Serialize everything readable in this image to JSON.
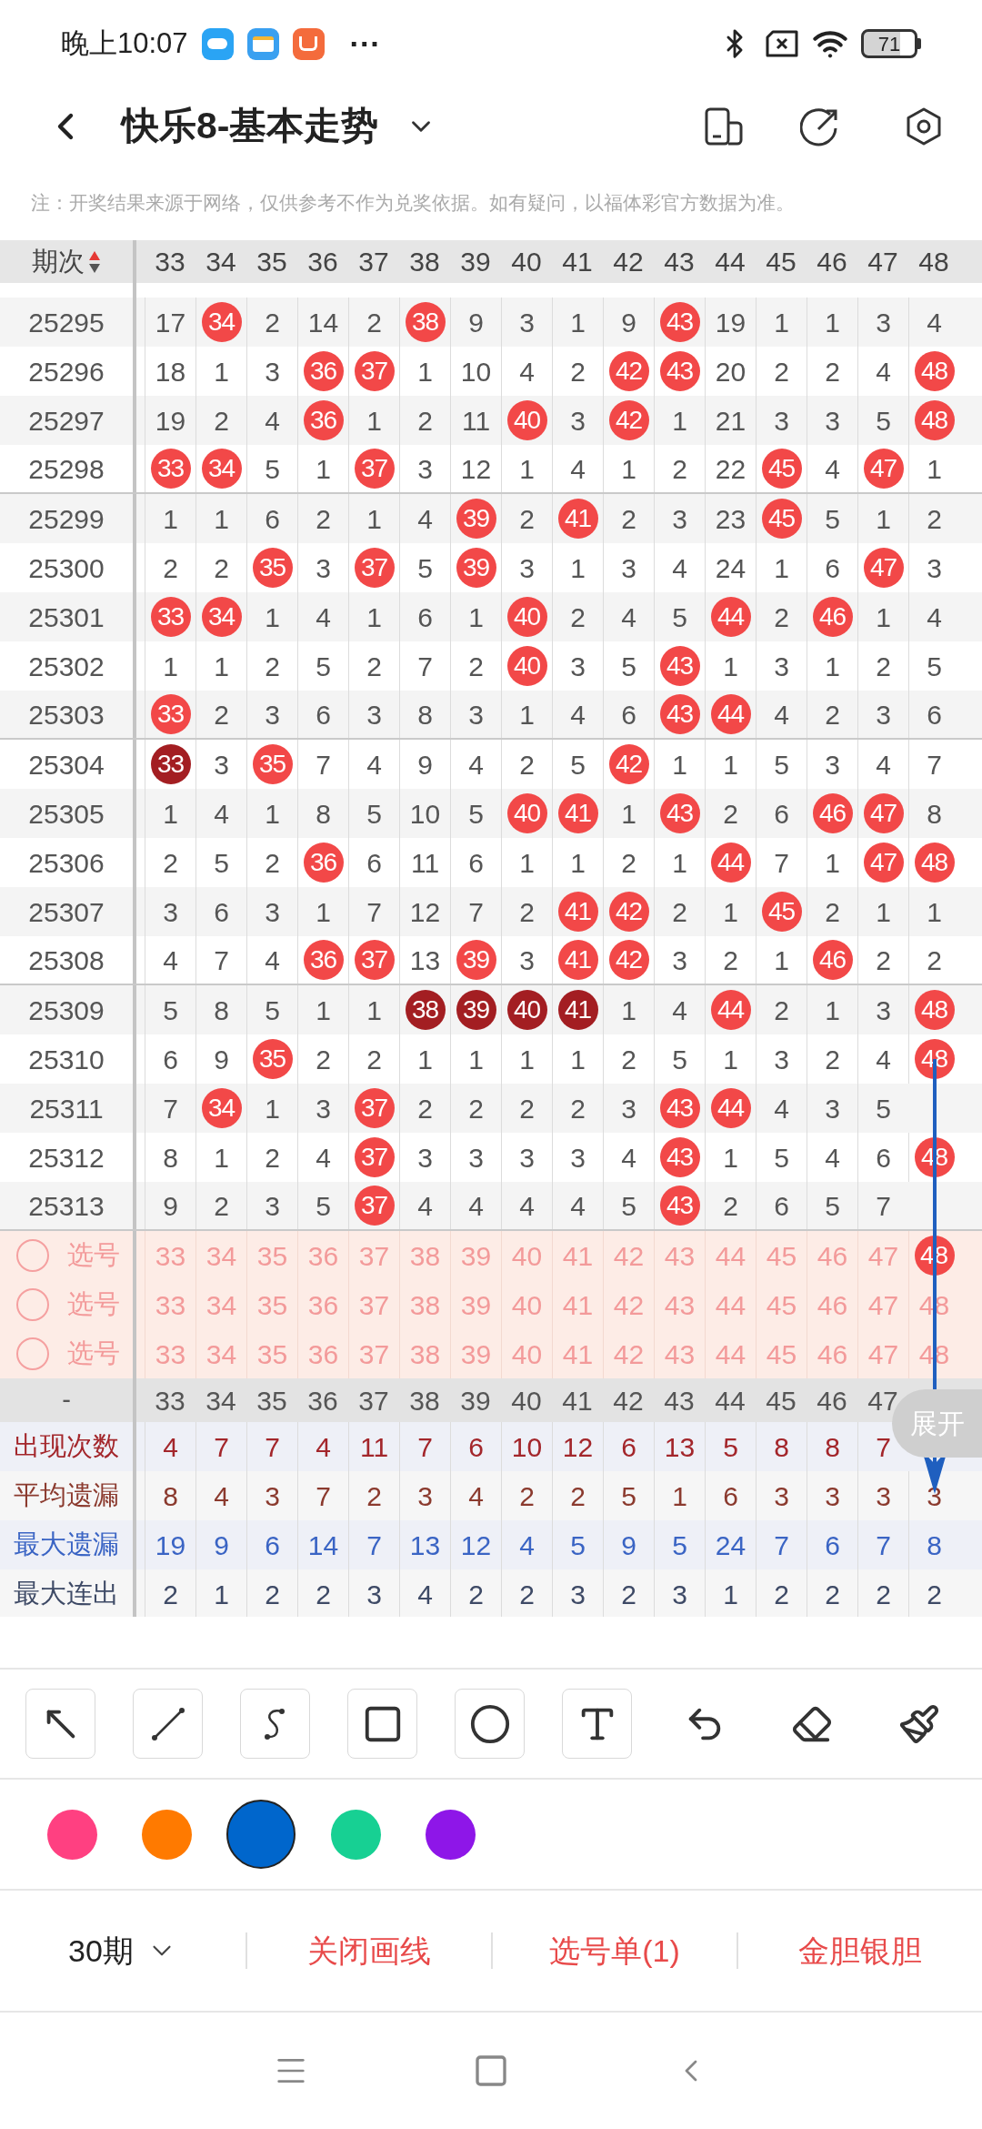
{
  "status_bar": {
    "time": "晚上10:07",
    "more": "···",
    "battery": "71"
  },
  "header": {
    "title": "快乐8-基本走势"
  },
  "notice": "注：开奖结果来源于网络，仅供参考不作为兑奖依据。如有疑问，以福体彩官方数据为准。",
  "table": {
    "period_header": "期次",
    "columns": [
      "33",
      "34",
      "35",
      "36",
      "37",
      "38",
      "39",
      "40",
      "41",
      "42",
      "43",
      "44",
      "45",
      "46",
      "47",
      "48"
    ],
    "rows": [
      {
        "period": "25295",
        "cells": [
          {
            "v": "17",
            "kind": "miss"
          },
          {
            "v": "34",
            "kind": "hit"
          },
          {
            "v": "2",
            "kind": "miss"
          },
          {
            "v": "14",
            "kind": "miss"
          },
          {
            "v": "2",
            "kind": "miss"
          },
          {
            "v": "38",
            "kind": "hit"
          },
          {
            "v": "9",
            "kind": "miss"
          },
          {
            "v": "3",
            "kind": "miss"
          },
          {
            "v": "1",
            "kind": "miss"
          },
          {
            "v": "9",
            "kind": "miss"
          },
          {
            "v": "43",
            "kind": "hit"
          },
          {
            "v": "19",
            "kind": "miss"
          },
          {
            "v": "1",
            "kind": "miss"
          },
          {
            "v": "1",
            "kind": "miss"
          },
          {
            "v": "3",
            "kind": "miss"
          },
          {
            "v": "4",
            "kind": "miss"
          }
        ]
      },
      {
        "period": "25296",
        "cells": [
          {
            "v": "18",
            "kind": "miss"
          },
          {
            "v": "1",
            "kind": "miss"
          },
          {
            "v": "3",
            "kind": "miss"
          },
          {
            "v": "36",
            "kind": "hit"
          },
          {
            "v": "37",
            "kind": "hit"
          },
          {
            "v": "1",
            "kind": "miss"
          },
          {
            "v": "10",
            "kind": "miss"
          },
          {
            "v": "4",
            "kind": "miss"
          },
          {
            "v": "2",
            "kind": "miss"
          },
          {
            "v": "42",
            "kind": "hit"
          },
          {
            "v": "43",
            "kind": "hit"
          },
          {
            "v": "20",
            "kind": "miss"
          },
          {
            "v": "2",
            "kind": "miss"
          },
          {
            "v": "2",
            "kind": "miss"
          },
          {
            "v": "4",
            "kind": "miss"
          },
          {
            "v": "48",
            "kind": "hit"
          }
        ]
      },
      {
        "period": "25297",
        "cells": [
          {
            "v": "19",
            "kind": "miss"
          },
          {
            "v": "2",
            "kind": "miss"
          },
          {
            "v": "4",
            "kind": "miss"
          },
          {
            "v": "36",
            "kind": "hit"
          },
          {
            "v": "1",
            "kind": "miss"
          },
          {
            "v": "2",
            "kind": "miss"
          },
          {
            "v": "11",
            "kind": "miss"
          },
          {
            "v": "40",
            "kind": "hit"
          },
          {
            "v": "3",
            "kind": "miss"
          },
          {
            "v": "42",
            "kind": "hit"
          },
          {
            "v": "1",
            "kind": "miss"
          },
          {
            "v": "21",
            "kind": "miss"
          },
          {
            "v": "3",
            "kind": "miss"
          },
          {
            "v": "3",
            "kind": "miss"
          },
          {
            "v": "5",
            "kind": "miss"
          },
          {
            "v": "48",
            "kind": "hit"
          }
        ]
      },
      {
        "period": "25298",
        "cells": [
          {
            "v": "33",
            "kind": "hit"
          },
          {
            "v": "34",
            "kind": "hit"
          },
          {
            "v": "5",
            "kind": "miss"
          },
          {
            "v": "1",
            "kind": "miss"
          },
          {
            "v": "37",
            "kind": "hit"
          },
          {
            "v": "3",
            "kind": "miss"
          },
          {
            "v": "12",
            "kind": "miss"
          },
          {
            "v": "1",
            "kind": "miss"
          },
          {
            "v": "4",
            "kind": "miss"
          },
          {
            "v": "1",
            "kind": "miss"
          },
          {
            "v": "2",
            "kind": "miss"
          },
          {
            "v": "22",
            "kind": "miss"
          },
          {
            "v": "45",
            "kind": "hit"
          },
          {
            "v": "4",
            "kind": "miss"
          },
          {
            "v": "47",
            "kind": "hit"
          },
          {
            "v": "1",
            "kind": "miss"
          }
        ]
      },
      {
        "period": "25299",
        "cells": [
          {
            "v": "1",
            "kind": "miss"
          },
          {
            "v": "1",
            "kind": "miss"
          },
          {
            "v": "6",
            "kind": "miss"
          },
          {
            "v": "2",
            "kind": "miss"
          },
          {
            "v": "1",
            "kind": "miss"
          },
          {
            "v": "4",
            "kind": "miss"
          },
          {
            "v": "39",
            "kind": "hit"
          },
          {
            "v": "2",
            "kind": "miss"
          },
          {
            "v": "41",
            "kind": "hit"
          },
          {
            "v": "2",
            "kind": "miss"
          },
          {
            "v": "3",
            "kind": "miss"
          },
          {
            "v": "23",
            "kind": "miss"
          },
          {
            "v": "45",
            "kind": "hit"
          },
          {
            "v": "5",
            "kind": "miss"
          },
          {
            "v": "1",
            "kind": "miss"
          },
          {
            "v": "2",
            "kind": "miss"
          }
        ]
      },
      {
        "period": "25300",
        "cells": [
          {
            "v": "2",
            "kind": "miss"
          },
          {
            "v": "2",
            "kind": "miss"
          },
          {
            "v": "35",
            "kind": "hit"
          },
          {
            "v": "3",
            "kind": "miss"
          },
          {
            "v": "37",
            "kind": "hit"
          },
          {
            "v": "5",
            "kind": "miss"
          },
          {
            "v": "39",
            "kind": "hit"
          },
          {
            "v": "3",
            "kind": "miss"
          },
          {
            "v": "1",
            "kind": "miss"
          },
          {
            "v": "3",
            "kind": "miss"
          },
          {
            "v": "4",
            "kind": "miss"
          },
          {
            "v": "24",
            "kind": "miss"
          },
          {
            "v": "1",
            "kind": "miss"
          },
          {
            "v": "6",
            "kind": "miss"
          },
          {
            "v": "47",
            "kind": "hit"
          },
          {
            "v": "3",
            "kind": "miss"
          }
        ]
      },
      {
        "period": "25301",
        "cells": [
          {
            "v": "33",
            "kind": "hit"
          },
          {
            "v": "34",
            "kind": "hit"
          },
          {
            "v": "1",
            "kind": "miss"
          },
          {
            "v": "4",
            "kind": "miss"
          },
          {
            "v": "1",
            "kind": "miss"
          },
          {
            "v": "6",
            "kind": "miss"
          },
          {
            "v": "1",
            "kind": "miss"
          },
          {
            "v": "40",
            "kind": "hit"
          },
          {
            "v": "2",
            "kind": "miss"
          },
          {
            "v": "4",
            "kind": "miss"
          },
          {
            "v": "5",
            "kind": "miss"
          },
          {
            "v": "44",
            "kind": "hit"
          },
          {
            "v": "2",
            "kind": "miss"
          },
          {
            "v": "46",
            "kind": "hit"
          },
          {
            "v": "1",
            "kind": "miss"
          },
          {
            "v": "4",
            "kind": "miss"
          }
        ]
      },
      {
        "period": "25302",
        "cells": [
          {
            "v": "1",
            "kind": "miss"
          },
          {
            "v": "1",
            "kind": "miss"
          },
          {
            "v": "2",
            "kind": "miss"
          },
          {
            "v": "5",
            "kind": "miss"
          },
          {
            "v": "2",
            "kind": "miss"
          },
          {
            "v": "7",
            "kind": "miss"
          },
          {
            "v": "2",
            "kind": "miss"
          },
          {
            "v": "40",
            "kind": "hit"
          },
          {
            "v": "3",
            "kind": "miss"
          },
          {
            "v": "5",
            "kind": "miss"
          },
          {
            "v": "43",
            "kind": "hit"
          },
          {
            "v": "1",
            "kind": "miss"
          },
          {
            "v": "3",
            "kind": "miss"
          },
          {
            "v": "1",
            "kind": "miss"
          },
          {
            "v": "2",
            "kind": "miss"
          },
          {
            "v": "5",
            "kind": "miss"
          }
        ]
      },
      {
        "period": "25303",
        "cells": [
          {
            "v": "33",
            "kind": "hit"
          },
          {
            "v": "2",
            "kind": "miss"
          },
          {
            "v": "3",
            "kind": "miss"
          },
          {
            "v": "6",
            "kind": "miss"
          },
          {
            "v": "3",
            "kind": "miss"
          },
          {
            "v": "8",
            "kind": "miss"
          },
          {
            "v": "3",
            "kind": "miss"
          },
          {
            "v": "1",
            "kind": "miss"
          },
          {
            "v": "4",
            "kind": "miss"
          },
          {
            "v": "6",
            "kind": "miss"
          },
          {
            "v": "43",
            "kind": "hit"
          },
          {
            "v": "44",
            "kind": "hit"
          },
          {
            "v": "4",
            "kind": "miss"
          },
          {
            "v": "2",
            "kind": "miss"
          },
          {
            "v": "3",
            "kind": "miss"
          },
          {
            "v": "6",
            "kind": "miss"
          }
        ]
      },
      {
        "period": "25304",
        "cells": [
          {
            "v": "33",
            "kind": "repeat"
          },
          {
            "v": "3",
            "kind": "miss"
          },
          {
            "v": "35",
            "kind": "hit"
          },
          {
            "v": "7",
            "kind": "miss"
          },
          {
            "v": "4",
            "kind": "miss"
          },
          {
            "v": "9",
            "kind": "miss"
          },
          {
            "v": "4",
            "kind": "miss"
          },
          {
            "v": "2",
            "kind": "miss"
          },
          {
            "v": "5",
            "kind": "miss"
          },
          {
            "v": "42",
            "kind": "hit"
          },
          {
            "v": "1",
            "kind": "miss"
          },
          {
            "v": "1",
            "kind": "miss"
          },
          {
            "v": "5",
            "kind": "miss"
          },
          {
            "v": "3",
            "kind": "miss"
          },
          {
            "v": "4",
            "kind": "miss"
          },
          {
            "v": "7",
            "kind": "miss"
          }
        ]
      },
      {
        "period": "25305",
        "cells": [
          {
            "v": "1",
            "kind": "miss"
          },
          {
            "v": "4",
            "kind": "miss"
          },
          {
            "v": "1",
            "kind": "miss"
          },
          {
            "v": "8",
            "kind": "miss"
          },
          {
            "v": "5",
            "kind": "miss"
          },
          {
            "v": "10",
            "kind": "miss"
          },
          {
            "v": "5",
            "kind": "miss"
          },
          {
            "v": "40",
            "kind": "hit"
          },
          {
            "v": "41",
            "kind": "hit"
          },
          {
            "v": "1",
            "kind": "miss"
          },
          {
            "v": "43",
            "kind": "hit"
          },
          {
            "v": "2",
            "kind": "miss"
          },
          {
            "v": "6",
            "kind": "miss"
          },
          {
            "v": "46",
            "kind": "hit"
          },
          {
            "v": "47",
            "kind": "hit"
          },
          {
            "v": "8",
            "kind": "miss"
          }
        ]
      },
      {
        "period": "25306",
        "cells": [
          {
            "v": "2",
            "kind": "miss"
          },
          {
            "v": "5",
            "kind": "miss"
          },
          {
            "v": "2",
            "kind": "miss"
          },
          {
            "v": "36",
            "kind": "hit"
          },
          {
            "v": "6",
            "kind": "miss"
          },
          {
            "v": "11",
            "kind": "miss"
          },
          {
            "v": "6",
            "kind": "miss"
          },
          {
            "v": "1",
            "kind": "miss"
          },
          {
            "v": "1",
            "kind": "miss"
          },
          {
            "v": "2",
            "kind": "miss"
          },
          {
            "v": "1",
            "kind": "miss"
          },
          {
            "v": "44",
            "kind": "hit"
          },
          {
            "v": "7",
            "kind": "miss"
          },
          {
            "v": "1",
            "kind": "miss"
          },
          {
            "v": "47",
            "kind": "hit"
          },
          {
            "v": "48",
            "kind": "hit"
          }
        ]
      },
      {
        "period": "25307",
        "cells": [
          {
            "v": "3",
            "kind": "miss"
          },
          {
            "v": "6",
            "kind": "miss"
          },
          {
            "v": "3",
            "kind": "miss"
          },
          {
            "v": "1",
            "kind": "miss"
          },
          {
            "v": "7",
            "kind": "miss"
          },
          {
            "v": "12",
            "kind": "miss"
          },
          {
            "v": "7",
            "kind": "miss"
          },
          {
            "v": "2",
            "kind": "miss"
          },
          {
            "v": "41",
            "kind": "hit"
          },
          {
            "v": "42",
            "kind": "hit"
          },
          {
            "v": "2",
            "kind": "miss"
          },
          {
            "v": "1",
            "kind": "miss"
          },
          {
            "v": "45",
            "kind": "hit"
          },
          {
            "v": "2",
            "kind": "miss"
          },
          {
            "v": "1",
            "kind": "miss"
          },
          {
            "v": "1",
            "kind": "miss"
          }
        ]
      },
      {
        "period": "25308",
        "cells": [
          {
            "v": "4",
            "kind": "miss"
          },
          {
            "v": "7",
            "kind": "miss"
          },
          {
            "v": "4",
            "kind": "miss"
          },
          {
            "v": "36",
            "kind": "hit"
          },
          {
            "v": "37",
            "kind": "hit"
          },
          {
            "v": "13",
            "kind": "miss"
          },
          {
            "v": "39",
            "kind": "hit"
          },
          {
            "v": "3",
            "kind": "miss"
          },
          {
            "v": "41",
            "kind": "hit"
          },
          {
            "v": "42",
            "kind": "hit"
          },
          {
            "v": "3",
            "kind": "miss"
          },
          {
            "v": "2",
            "kind": "miss"
          },
          {
            "v": "1",
            "kind": "miss"
          },
          {
            "v": "46",
            "kind": "hit"
          },
          {
            "v": "2",
            "kind": "miss"
          },
          {
            "v": "2",
            "kind": "miss"
          }
        ]
      },
      {
        "period": "25309",
        "cells": [
          {
            "v": "5",
            "kind": "miss"
          },
          {
            "v": "8",
            "kind": "miss"
          },
          {
            "v": "5",
            "kind": "miss"
          },
          {
            "v": "1",
            "kind": "miss"
          },
          {
            "v": "1",
            "kind": "miss"
          },
          {
            "v": "38",
            "kind": "repeat"
          },
          {
            "v": "39",
            "kind": "repeat"
          },
          {
            "v": "40",
            "kind": "repeat"
          },
          {
            "v": "41",
            "kind": "repeat"
          },
          {
            "v": "1",
            "kind": "miss"
          },
          {
            "v": "4",
            "kind": "miss"
          },
          {
            "v": "44",
            "kind": "hit"
          },
          {
            "v": "2",
            "kind": "miss"
          },
          {
            "v": "1",
            "kind": "miss"
          },
          {
            "v": "3",
            "kind": "miss"
          },
          {
            "v": "48",
            "kind": "hit"
          }
        ]
      },
      {
        "period": "25310",
        "cells": [
          {
            "v": "6",
            "kind": "miss"
          },
          {
            "v": "9",
            "kind": "miss"
          },
          {
            "v": "35",
            "kind": "hit"
          },
          {
            "v": "2",
            "kind": "miss"
          },
          {
            "v": "2",
            "kind": "miss"
          },
          {
            "v": "1",
            "kind": "miss"
          },
          {
            "v": "1",
            "kind": "miss"
          },
          {
            "v": "1",
            "kind": "miss"
          },
          {
            "v": "1",
            "kind": "miss"
          },
          {
            "v": "2",
            "kind": "miss"
          },
          {
            "v": "5",
            "kind": "miss"
          },
          {
            "v": "1",
            "kind": "miss"
          },
          {
            "v": "3",
            "kind": "miss"
          },
          {
            "v": "2",
            "kind": "miss"
          },
          {
            "v": "4",
            "kind": "miss"
          },
          {
            "v": "48",
            "kind": "hit"
          }
        ]
      },
      {
        "period": "25311",
        "cells": [
          {
            "v": "7",
            "kind": "miss"
          },
          {
            "v": "34",
            "kind": "hit"
          },
          {
            "v": "1",
            "kind": "miss"
          },
          {
            "v": "3",
            "kind": "miss"
          },
          {
            "v": "37",
            "kind": "hit"
          },
          {
            "v": "2",
            "kind": "miss"
          },
          {
            "v": "2",
            "kind": "miss"
          },
          {
            "v": "2",
            "kind": "miss"
          },
          {
            "v": "2",
            "kind": "miss"
          },
          {
            "v": "3",
            "kind": "miss"
          },
          {
            "v": "43",
            "kind": "hit"
          },
          {
            "v": "44",
            "kind": "hit"
          },
          {
            "v": "4",
            "kind": "miss"
          },
          {
            "v": "3",
            "kind": "miss"
          },
          {
            "v": "5",
            "kind": "miss"
          }
        ]
      },
      {
        "period": "25312",
        "cells": [
          {
            "v": "8",
            "kind": "miss"
          },
          {
            "v": "1",
            "kind": "miss"
          },
          {
            "v": "2",
            "kind": "miss"
          },
          {
            "v": "4",
            "kind": "miss"
          },
          {
            "v": "37",
            "kind": "hit"
          },
          {
            "v": "3",
            "kind": "miss"
          },
          {
            "v": "3",
            "kind": "miss"
          },
          {
            "v": "3",
            "kind": "miss"
          },
          {
            "v": "3",
            "kind": "miss"
          },
          {
            "v": "4",
            "kind": "miss"
          },
          {
            "v": "43",
            "kind": "hit"
          },
          {
            "v": "1",
            "kind": "miss"
          },
          {
            "v": "5",
            "kind": "miss"
          },
          {
            "v": "4",
            "kind": "miss"
          },
          {
            "v": "6",
            "kind": "miss"
          },
          {
            "v": "48",
            "kind": "hit"
          }
        ]
      },
      {
        "period": "25313",
        "cells": [
          {
            "v": "9",
            "kind": "miss"
          },
          {
            "v": "2",
            "kind": "miss"
          },
          {
            "v": "3",
            "kind": "miss"
          },
          {
            "v": "5",
            "kind": "miss"
          },
          {
            "v": "37",
            "kind": "hit"
          },
          {
            "v": "4",
            "kind": "miss"
          },
          {
            "v": "4",
            "kind": "miss"
          },
          {
            "v": "4",
            "kind": "miss"
          },
          {
            "v": "4",
            "kind": "miss"
          },
          {
            "v": "5",
            "kind": "miss"
          },
          {
            "v": "43",
            "kind": "hit"
          },
          {
            "v": "2",
            "kind": "miss"
          },
          {
            "v": "6",
            "kind": "miss"
          },
          {
            "v": "5",
            "kind": "miss"
          },
          {
            "v": "7",
            "kind": "miss"
          }
        ]
      }
    ],
    "pick_rows": [
      {
        "label": "选号",
        "checked": false,
        "cells": [
          {
            "v": "33",
            "selected": false
          },
          {
            "v": "34",
            "selected": false
          },
          {
            "v": "35",
            "selected": false
          },
          {
            "v": "36",
            "selected": false
          },
          {
            "v": "37",
            "selected": false
          },
          {
            "v": "38",
            "selected": false
          },
          {
            "v": "39",
            "selected": false
          },
          {
            "v": "40",
            "selected": false
          },
          {
            "v": "41",
            "selected": false
          },
          {
            "v": "42",
            "selected": false
          },
          {
            "v": "43",
            "selected": false
          },
          {
            "v": "44",
            "selected": false
          },
          {
            "v": "45",
            "selected": false
          },
          {
            "v": "46",
            "selected": false
          },
          {
            "v": "47",
            "selected": false
          },
          {
            "v": "48",
            "selected": true
          }
        ]
      },
      {
        "label": "选号",
        "checked": false,
        "cells": [
          {
            "v": "33",
            "selected": false
          },
          {
            "v": "34",
            "selected": false
          },
          {
            "v": "35",
            "selected": false
          },
          {
            "v": "36",
            "selected": false
          },
          {
            "v": "37",
            "selected": false
          },
          {
            "v": "38",
            "selected": false
          },
          {
            "v": "39",
            "selected": false
          },
          {
            "v": "40",
            "selected": false
          },
          {
            "v": "41",
            "selected": false
          },
          {
            "v": "42",
            "selected": false
          },
          {
            "v": "43",
            "selected": false
          },
          {
            "v": "44",
            "selected": false
          },
          {
            "v": "45",
            "selected": false
          },
          {
            "v": "46",
            "selected": false
          },
          {
            "v": "47",
            "selected": false
          },
          {
            "v": "48",
            "selected": false
          }
        ]
      },
      {
        "label": "选号",
        "checked": false,
        "cells": [
          {
            "v": "33",
            "selected": false
          },
          {
            "v": "34",
            "selected": false
          },
          {
            "v": "35",
            "selected": false
          },
          {
            "v": "36",
            "selected": false
          },
          {
            "v": "37",
            "selected": false
          },
          {
            "v": "38",
            "selected": false
          },
          {
            "v": "39",
            "selected": false
          },
          {
            "v": "40",
            "selected": false
          },
          {
            "v": "41",
            "selected": false
          },
          {
            "v": "42",
            "selected": false
          },
          {
            "v": "43",
            "selected": false
          },
          {
            "v": "44",
            "selected": false
          },
          {
            "v": "45",
            "selected": false
          },
          {
            "v": "46",
            "selected": false
          },
          {
            "v": "47",
            "selected": false
          },
          {
            "v": "48",
            "selected": false
          }
        ]
      }
    ],
    "footer_header": {
      "label": "-",
      "cells": [
        "33",
        "34",
        "35",
        "36",
        "37",
        "38",
        "39",
        "40",
        "41",
        "42",
        "43",
        "44",
        "45",
        "46",
        "47"
      ]
    },
    "stats": [
      {
        "label": "出现次数",
        "color": "#a3262b",
        "cells": [
          "4",
          "7",
          "7",
          "4",
          "11",
          "7",
          "6",
          "10",
          "12",
          "6",
          "13",
          "5",
          "8",
          "8",
          "7"
        ]
      },
      {
        "label": "平均遗漏",
        "color": "#8b3a2e",
        "cells": [
          "8",
          "4",
          "3",
          "7",
          "2",
          "3",
          "4",
          "2",
          "2",
          "5",
          "1",
          "6",
          "3",
          "3",
          "3",
          "3"
        ]
      },
      {
        "label": "最大遗漏",
        "color": "#3a64c4",
        "cells": [
          "19",
          "9",
          "6",
          "14",
          "7",
          "13",
          "12",
          "4",
          "5",
          "9",
          "5",
          "24",
          "7",
          "6",
          "7",
          "8"
        ]
      },
      {
        "label": "最大连出",
        "color": "#3e4a66",
        "cells": [
          "2",
          "1",
          "2",
          "2",
          "3",
          "4",
          "2",
          "2",
          "3",
          "2",
          "3",
          "1",
          "2",
          "2",
          "2",
          "2"
        ]
      }
    ]
  },
  "expand_button": "展开",
  "tools": [
    {
      "kind": "arrow"
    },
    {
      "kind": "line"
    },
    {
      "kind": "curve"
    },
    {
      "kind": "rect"
    },
    {
      "kind": "circle"
    },
    {
      "kind": "text"
    },
    {
      "kind": "undo"
    },
    {
      "kind": "eraser"
    },
    {
      "kind": "brush"
    }
  ],
  "colors": [
    {
      "color": "#ff4081",
      "selected": false
    },
    {
      "color": "#ff7a00",
      "selected": false
    },
    {
      "color": "#0066cc",
      "selected": true
    },
    {
      "color": "#17d093",
      "selected": false
    },
    {
      "color": "#8e16e8",
      "selected": false
    }
  ],
  "bottom_bar": {
    "period": "30期",
    "actions": [
      "关闭画线",
      "选号单(1)",
      "金胆银胆"
    ]
  }
}
